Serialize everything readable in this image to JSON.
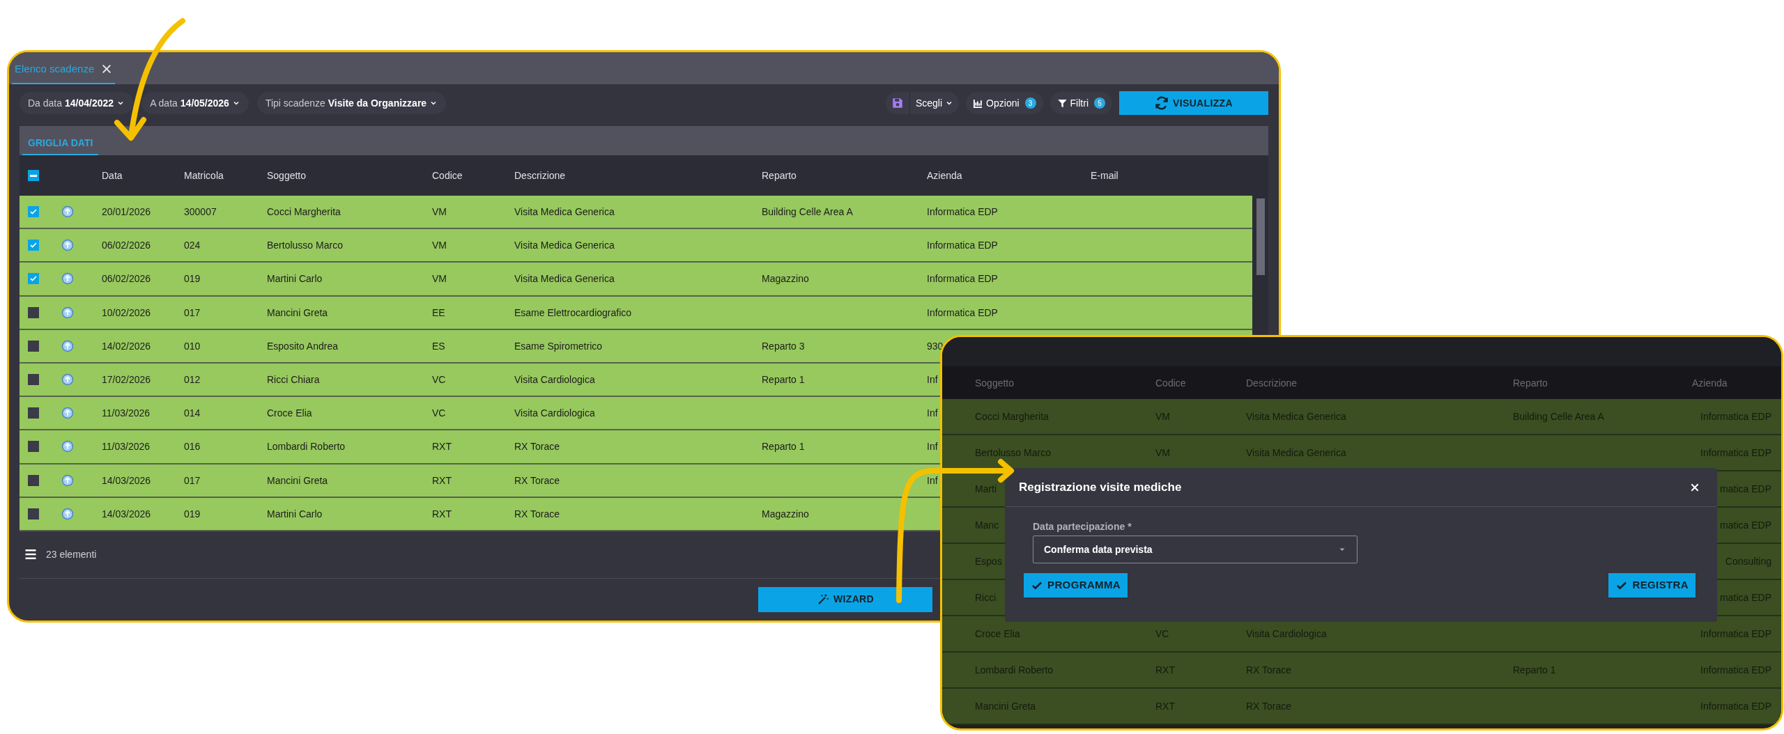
{
  "main_window": {
    "tab": {
      "label": "Elenco scadenze",
      "selected": true
    },
    "filters": [
      {
        "label": "Da data",
        "value": "14/04/2022"
      },
      {
        "label": "A data",
        "value": "14/05/2026"
      },
      {
        "label": "Tipi scadenze",
        "value": "Visite da Organizzare"
      }
    ],
    "layout_picker": {
      "label": "Scegli"
    },
    "options": {
      "label": "Opzioni",
      "badge": "3"
    },
    "filters_button": {
      "label": "Filtri",
      "badge": "5"
    },
    "view_button": "VISUALIZZA",
    "subtab": {
      "label": "GRIGLIA DATI",
      "selected": true
    },
    "select_all": {
      "indeterminate": true
    },
    "columns": [
      "Data",
      "Matricola",
      "Soggetto",
      "Codice",
      "Descrizione",
      "Reparto",
      "Azienda",
      "E-mail"
    ],
    "rows": [
      {
        "checked": true,
        "data": "20/01/2026",
        "matricola": "300007",
        "soggetto": "Cocci Margherita",
        "codice": "VM",
        "descrizione": "Visita Medica Generica",
        "reparto": "Building Celle Area A",
        "azienda": "Informatica EDP"
      },
      {
        "checked": true,
        "data": "06/02/2026",
        "matricola": "024",
        "soggetto": "Bertolusso Marco",
        "codice": "VM",
        "descrizione": "Visita Medica Generica",
        "azienda": "Informatica EDP"
      },
      {
        "checked": true,
        "data": "06/02/2026",
        "matricola": "019",
        "soggetto": "Martini Carlo",
        "codice": "VM",
        "descrizione": "Visita Medica Generica",
        "reparto": "Magazzino",
        "azienda": "Informatica EDP"
      },
      {
        "checked": false,
        "data": "10/02/2026",
        "matricola": "017",
        "soggetto": "Mancini Greta",
        "codice": "EE",
        "descrizione": "Esame Elettrocardiografico",
        "azienda": "Informatica EDP"
      },
      {
        "checked": false,
        "data": "14/02/2026",
        "matricola": "010",
        "soggetto": "Esposito Andrea",
        "codice": "ES",
        "descrizione": "Esame Spirometrico",
        "reparto": "Reparto 3",
        "azienda": "930"
      },
      {
        "checked": false,
        "data": "17/02/2026",
        "matricola": "012",
        "soggetto": "Ricci Chiara",
        "codice": "VC",
        "descrizione": "Visita Cardiologica",
        "reparto": "Reparto 1",
        "azienda": "Inf"
      },
      {
        "checked": false,
        "data": "11/03/2026",
        "matricola": "014",
        "soggetto": "Croce Elia",
        "codice": "VC",
        "descrizione": "Visita Cardiologica",
        "azienda": "Inf"
      },
      {
        "checked": false,
        "data": "11/03/2026",
        "matricola": "016",
        "soggetto": "Lombardi Roberto",
        "codice": "RXT",
        "descrizione": "RX Torace",
        "reparto": "Reparto 1",
        "azienda": "Inf"
      },
      {
        "checked": false,
        "data": "14/03/2026",
        "matricola": "017",
        "soggetto": "Mancini Greta",
        "codice": "RXT",
        "descrizione": "RX Torace",
        "azienda": "Inf"
      },
      {
        "checked": false,
        "data": "14/03/2026",
        "matricola": "019",
        "soggetto": "Martini Carlo",
        "codice": "RXT",
        "descrizione": "RX Torace",
        "reparto": "Magazzino"
      }
    ],
    "count": "23 elementi",
    "wizard_button": "WIZARD"
  },
  "detail_window": {
    "columns": [
      "Soggetto",
      "Codice",
      "Descrizione",
      "Reparto",
      "Azienda"
    ],
    "rows": [
      {
        "soggetto": "Cocci Margherita",
        "codice": "VM",
        "descrizione": "Visita Medica Generica",
        "reparto": "Building Celle Area A",
        "azienda": "Informatica EDP"
      },
      {
        "soggetto": "Bertolusso Marco",
        "codice": "VM",
        "descrizione": "Visita Medica Generica",
        "azienda": "Informatica EDP"
      },
      {
        "soggetto": "Marti",
        "azienda": "matica EDP"
      },
      {
        "soggetto": "Manc",
        "azienda": "matica EDP"
      },
      {
        "soggetto": "Espos",
        "azienda": "Consulting"
      },
      {
        "soggetto": "Ricci",
        "azienda": "matica EDP"
      },
      {
        "soggetto": "Croce Elia",
        "codice": "VC",
        "descrizione": "Visita Cardiologica",
        "azienda": "Informatica EDP"
      },
      {
        "soggetto": "Lombardi Roberto",
        "codice": "RXT",
        "descrizione": "RX Torace",
        "reparto": "Reparto 1",
        "azienda": "Informatica EDP"
      },
      {
        "soggetto": "Mancini Greta",
        "codice": "RXT",
        "descrizione": "RX Torace",
        "azienda": "Informatica EDP"
      }
    ],
    "dialog": {
      "title": "Registrazione visite mediche",
      "field_label": "Data partecipazione *",
      "field_value": "Conferma data prevista",
      "buttons": [
        "PROGRAMMA",
        "REGISTRA"
      ]
    }
  }
}
